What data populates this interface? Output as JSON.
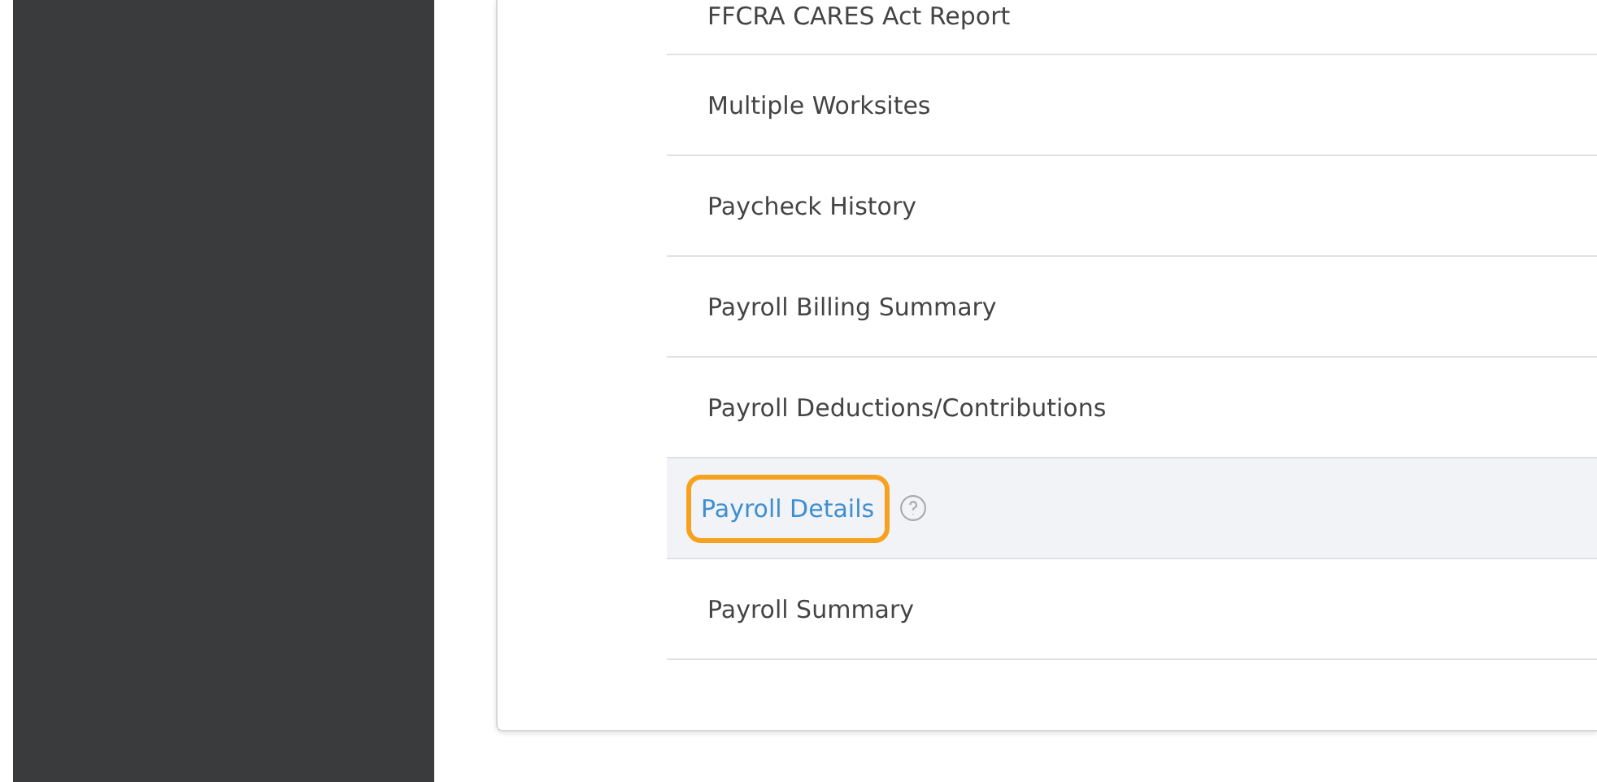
{
  "reports": [
    {
      "label": "FFCRA CARES Act Report",
      "selected": false,
      "help": false
    },
    {
      "label": "Multiple Worksites",
      "selected": false,
      "help": false
    },
    {
      "label": "Paycheck History",
      "selected": false,
      "help": false
    },
    {
      "label": "Payroll Billing Summary",
      "selected": false,
      "help": false
    },
    {
      "label": "Payroll Deductions/Contributions",
      "selected": false,
      "help": false
    },
    {
      "label": "Payroll Details",
      "selected": true,
      "help": true
    },
    {
      "label": "Payroll Summary",
      "selected": false,
      "help": false
    }
  ]
}
